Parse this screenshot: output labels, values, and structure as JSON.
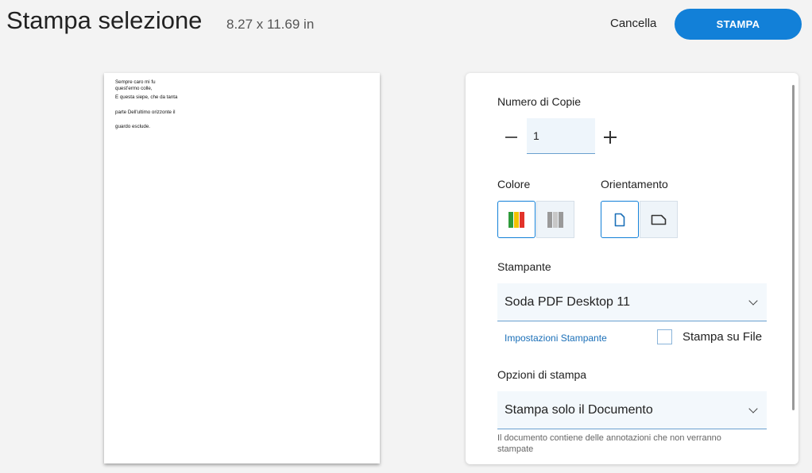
{
  "header": {
    "title": "Stampa selezione",
    "page_size": "8.27 x 11.69 in",
    "cancel_label": "Cancella",
    "print_label": "STAMPA"
  },
  "preview": {
    "lines": [
      "Sempre caro mi fu",
      "quest'ermo colle,",
      "E questa siepe, che da tanta",
      "parte Dell'ultimo orizzonte il",
      "guardo esclude."
    ]
  },
  "settings": {
    "copies_label": "Numero di Copie",
    "copies_value": "1",
    "color_label": "Colore",
    "orientation_label": "Orientamento",
    "printer_label": "Stampante",
    "printer_value": "Soda PDF Desktop 11",
    "printer_settings_link": "Impostazioni Stampante",
    "print_to_file_label": "Stampa su File",
    "print_options_label": "Opzioni di stampa",
    "print_options_value": "Stampa solo il Documento",
    "note": "Il documento contiene delle annotazioni che non verranno stampate"
  },
  "colors": {
    "accent": "#1280d8",
    "color_icon": [
      "#2e9b3a",
      "#f2c200",
      "#e2332a"
    ],
    "gray_icon": [
      "#9a9a9a",
      "#c7c7c7",
      "#9a9a9a"
    ]
  },
  "icons": [
    "minus-icon",
    "plus-icon",
    "color-icon",
    "grayscale-icon",
    "portrait-icon",
    "landscape-icon",
    "chevron-down-icon"
  ]
}
